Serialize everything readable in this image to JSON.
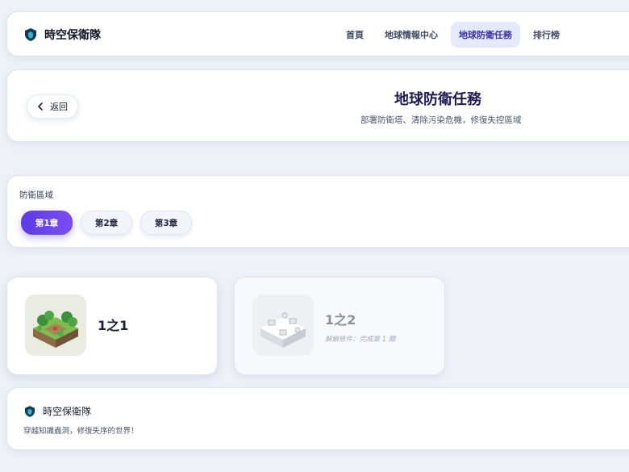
{
  "nav": {
    "brand": "時空保衛隊",
    "links": [
      {
        "label": "首頁"
      },
      {
        "label": "地球情報中心"
      },
      {
        "label": "地球防衛任務"
      },
      {
        "label": "排行榜"
      }
    ],
    "active_index": 2
  },
  "header": {
    "back_label": "返回",
    "title": "地球防衛任務",
    "subtitle": "部署防衛塔、清除污染危機，修復失控區域"
  },
  "chapters": {
    "label": "防衛區域",
    "items": [
      {
        "label": "第1章"
      },
      {
        "label": "第2章"
      },
      {
        "label": "第3章"
      }
    ],
    "selected_index": 0
  },
  "levels": [
    {
      "name": "1之1",
      "locked": false,
      "icon": "forest-island-icon"
    },
    {
      "name": "1之2",
      "locked": true,
      "icon": "polluted-island-icon",
      "unlock_note": "解鎖條件：完成第 1 關"
    }
  ],
  "footer": {
    "brand": "時空保衛隊",
    "tagline": "穿越知識蟲洞，修復失序的世界！"
  },
  "colors": {
    "accent": "#5b3de6",
    "nav_active_bg": "#e4e9fb",
    "background": "#eef1f7"
  }
}
